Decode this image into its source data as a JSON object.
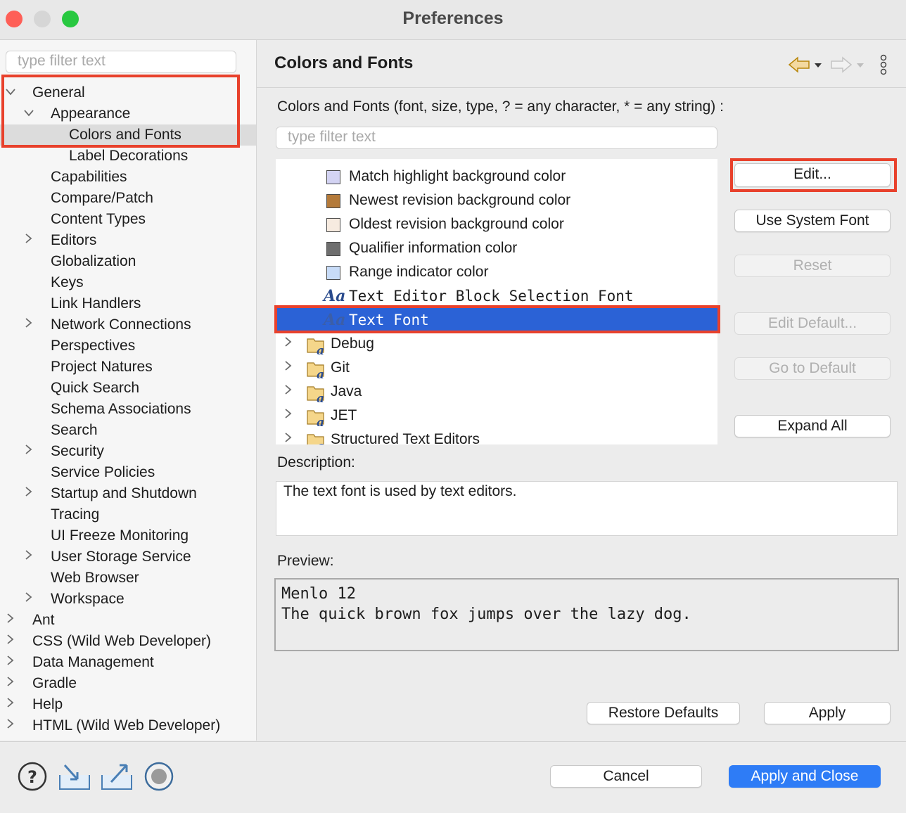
{
  "window": {
    "title": "Preferences"
  },
  "colors": {
    "close": "#fe5f57",
    "minimize": "#d6d6d6",
    "maximize": "#28c840",
    "selection": "#2b62d6",
    "annotation": "#e8412c",
    "primary": "#2e7cf6"
  },
  "left": {
    "filter_placeholder": "type filter text",
    "tree": [
      {
        "label": "General",
        "level": 0,
        "expander": "expanded"
      },
      {
        "label": "Appearance",
        "level": 1,
        "expander": "expanded"
      },
      {
        "label": "Colors and Fonts",
        "level": 2,
        "expander": "none",
        "selected": true
      },
      {
        "label": "Label Decorations",
        "level": 2,
        "expander": "none"
      },
      {
        "label": "Capabilities",
        "level": 1,
        "expander": "none"
      },
      {
        "label": "Compare/Patch",
        "level": 1,
        "expander": "none"
      },
      {
        "label": "Content Types",
        "level": 1,
        "expander": "none"
      },
      {
        "label": "Editors",
        "level": 1,
        "expander": "collapsed"
      },
      {
        "label": "Globalization",
        "level": 1,
        "expander": "none"
      },
      {
        "label": "Keys",
        "level": 1,
        "expander": "none"
      },
      {
        "label": "Link Handlers",
        "level": 1,
        "expander": "none"
      },
      {
        "label": "Network Connections",
        "level": 1,
        "expander": "collapsed"
      },
      {
        "label": "Perspectives",
        "level": 1,
        "expander": "none"
      },
      {
        "label": "Project Natures",
        "level": 1,
        "expander": "none"
      },
      {
        "label": "Quick Search",
        "level": 1,
        "expander": "none"
      },
      {
        "label": "Schema Associations",
        "level": 1,
        "expander": "none"
      },
      {
        "label": "Search",
        "level": 1,
        "expander": "none"
      },
      {
        "label": "Security",
        "level": 1,
        "expander": "collapsed"
      },
      {
        "label": "Service Policies",
        "level": 1,
        "expander": "none"
      },
      {
        "label": "Startup and Shutdown",
        "level": 1,
        "expander": "collapsed"
      },
      {
        "label": "Tracing",
        "level": 1,
        "expander": "none"
      },
      {
        "label": "UI Freeze Monitoring",
        "level": 1,
        "expander": "none"
      },
      {
        "label": "User Storage Service",
        "level": 1,
        "expander": "collapsed"
      },
      {
        "label": "Web Browser",
        "level": 1,
        "expander": "none"
      },
      {
        "label": "Workspace",
        "level": 1,
        "expander": "collapsed"
      },
      {
        "label": "Ant",
        "level": 0,
        "expander": "collapsed"
      },
      {
        "label": "CSS (Wild Web Developer)",
        "level": 0,
        "expander": "collapsed"
      },
      {
        "label": "Data Management",
        "level": 0,
        "expander": "collapsed"
      },
      {
        "label": "Gradle",
        "level": 0,
        "expander": "collapsed"
      },
      {
        "label": "Help",
        "level": 0,
        "expander": "collapsed"
      },
      {
        "label": "HTML (Wild Web Developer)",
        "level": 0,
        "expander": "collapsed"
      }
    ]
  },
  "main": {
    "title": "Colors and Fonts",
    "instruction": "Colors and Fonts (font, size, type, ? = any character, * = any string) :",
    "filter_placeholder": "type filter text",
    "items": [
      {
        "label": "Match highlight background color",
        "kind": "color",
        "color": "#d3d3f3"
      },
      {
        "label": "Newest revision background color",
        "kind": "color",
        "color": "#b47a3a"
      },
      {
        "label": "Oldest revision background color",
        "kind": "color",
        "color": "#f7ebe0"
      },
      {
        "label": "Qualifier information color",
        "kind": "color",
        "color": "#6e6e6e"
      },
      {
        "label": "Range indicator color",
        "kind": "color",
        "color": "#c8dcf8"
      },
      {
        "label": "Text Editor Block Selection Font",
        "kind": "font"
      },
      {
        "label": "Text Font",
        "kind": "font",
        "selected": true
      },
      {
        "label": "Debug",
        "kind": "category"
      },
      {
        "label": "Git",
        "kind": "category"
      },
      {
        "label": "Java",
        "kind": "category"
      },
      {
        "label": "JET",
        "kind": "category"
      },
      {
        "label": "Structured Text Editors",
        "kind": "category"
      }
    ],
    "font_glyph": "Aa",
    "buttons": {
      "edit": "Edit...",
      "use_system_font": "Use System Font",
      "reset": "Reset",
      "edit_default": "Edit Default...",
      "go_to_default": "Go to Default",
      "expand_all": "Expand All"
    },
    "description_label": "Description:",
    "description_text": "The text font is used by text editors.",
    "preview_label": "Preview:",
    "preview_line1": "Menlo 12",
    "preview_line2": "The quick brown fox jumps over the lazy dog.",
    "restore_defaults": "Restore Defaults",
    "apply": "Apply"
  },
  "footer": {
    "cancel": "Cancel",
    "apply_and_close": "Apply and Close"
  }
}
